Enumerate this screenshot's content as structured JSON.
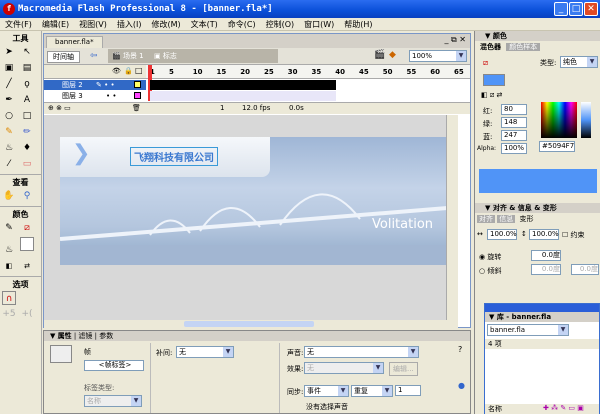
{
  "window": {
    "title": "Macromedia Flash Professional 8 - [banner.fla*]",
    "min": "_",
    "max": "□",
    "close": "✕"
  },
  "menu": [
    "文件(F)",
    "编辑(E)",
    "视图(V)",
    "插入(I)",
    "修改(M)",
    "文本(T)",
    "命令(C)",
    "控制(O)",
    "窗口(W)",
    "帮助(H)"
  ],
  "tools": {
    "title": "工具",
    "view": "查看",
    "colors": "颜色",
    "options": "选项"
  },
  "document": {
    "tab": "banner.fla*",
    "timeline_button": "时间轴",
    "scene": "场景 1",
    "symbol": "标志",
    "zoom": "100%"
  },
  "timeline": {
    "ruler": [
      "1",
      "5",
      "10",
      "15",
      "20",
      "25",
      "30",
      "35",
      "40",
      "45",
      "50",
      "55",
      "60",
      "65"
    ],
    "layers": [
      {
        "name": "图层 2",
        "selected": true,
        "color": "#ffff66"
      },
      {
        "name": "图层 3",
        "selected": false,
        "color": "#ff44ff"
      }
    ],
    "current_frame": "1",
    "fps": "12.0 fps",
    "time": "0.0s"
  },
  "stage": {
    "company": "飞翔科技有限公司",
    "tagline": "Volitation"
  },
  "properties": {
    "tabs": [
      "属性",
      "滤镜",
      "参数"
    ],
    "type": "帧",
    "frame_label_placeholder": "<帧标签>",
    "label_type_label": "标签类型:",
    "label_type": "名称",
    "tween_label": "补间:",
    "tween": "无",
    "sound_label": "声音:",
    "sound": "无",
    "effect_label": "效果:",
    "effect": "无",
    "edit_button": "编辑...",
    "sync_label": "同步:",
    "sync": "事件",
    "repeat": "重复",
    "repeat_count": "1",
    "no_sound": "没有选择声音"
  },
  "color_panel": {
    "title": "颜色",
    "tabs": [
      "混色器",
      "颜色样本"
    ],
    "type_label": "类型:",
    "type": "纯色",
    "red_label": "红:",
    "red": "80",
    "green_label": "绿:",
    "green": "148",
    "blue_label": "蓝:",
    "blue": "247",
    "alpha_label": "Alpha:",
    "alpha": "100%",
    "hex": "#5094F7",
    "swatch": "#5094f7"
  },
  "transform_panel": {
    "title": "对齐 & 信息 & 变形",
    "tabs": [
      "对齐",
      "信息",
      "变形"
    ],
    "width": "100.0%",
    "height": "100.0%",
    "constrain": "约束",
    "rotate_label": "旋转",
    "rotate": "0.0度",
    "skew_label": "倾斜",
    "skew_h": "0.0度",
    "skew_v": "0.0度"
  },
  "library": {
    "title": "库 - banner.fla",
    "file": "banner.fla",
    "count": "4 项",
    "name_col": "名称"
  }
}
